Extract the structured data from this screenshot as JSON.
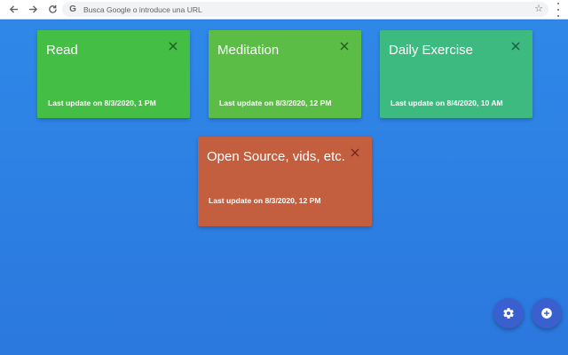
{
  "browser": {
    "back_icon": "arrow-left-icon",
    "forward_icon": "arrow-right-icon",
    "reload_icon": "reload-icon",
    "omnibox_placeholder": "Busca Google o introduce una URL",
    "google_logo": "G"
  },
  "cards": [
    {
      "title": "Read",
      "update": "Last update on 8/3/2020, 1 PM",
      "color": "#44be44"
    },
    {
      "title": "Meditation",
      "update": "Last update on 8/3/2020, 12 PM",
      "color": "#5bbd46"
    },
    {
      "title": "Daily Exercise",
      "update": "Last update on 8/4/2020, 10 AM",
      "color": "#3dba80"
    },
    {
      "title": "Open Source, vids, etc.",
      "update": "Last update on 8/3/2020, 12 PM",
      "color": "#c35e3e"
    }
  ],
  "fabs": {
    "settings_icon": "gear-icon",
    "add_icon": "plus-circle-icon"
  },
  "colors": {
    "background": "#2e7be0",
    "fab": "#3a5fcf"
  }
}
